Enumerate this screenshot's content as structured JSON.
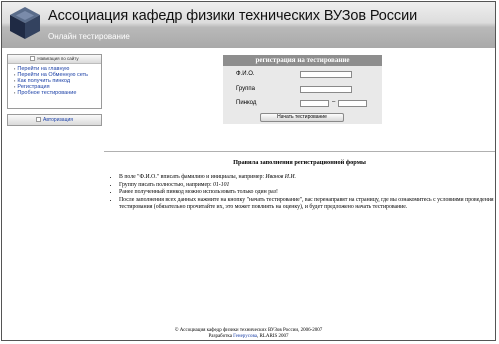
{
  "header": {
    "title": "Ассоциация кафедр физики технических ВУЗов России",
    "subtitle": "Онлайн тестирование"
  },
  "sidebar": {
    "nav_title": "Навигация по сайту",
    "items": [
      {
        "label": "Перейти на главную"
      },
      {
        "label": "Перейти на Обменную сеть"
      },
      {
        "label": "Как получить пинкод"
      },
      {
        "label": "Регистрация"
      },
      {
        "label": "Пробное тестирование"
      }
    ],
    "auth_label": "Авторизация"
  },
  "registration": {
    "title": "регистрация на тестирование",
    "fio_label": "Ф.И.О.",
    "group_label": "Группа",
    "pincode_label": "Пинкод",
    "pincode_separator": "–",
    "submit_label": "Начать тестирование",
    "fio_value": "",
    "group_value": "",
    "pincode_part1": "",
    "pincode_part2": ""
  },
  "rules": {
    "heading": "Правила заполнения регистрационной формы",
    "items": [
      {
        "text": "В поле \"Ф.И.О.\" вписать фамилию и инициалы, например: ",
        "example": "Иванов И.И."
      },
      {
        "text": "Группу писать полностью, например: ",
        "example": "01-101"
      },
      {
        "text": "Ранее полученный пинкод можно использовать только один раз!",
        "example": ""
      },
      {
        "text": "После заполнения всех данных нажмите на кнопку \"начать тестирование\", вас перенаправят на страницу, где вы ознакомитесь с условиями проведения тестирования (обязательно прочитайте их, это может повлиять на оценку), и будет предложено начать тестирование.",
        "example": ""
      }
    ]
  },
  "footer": {
    "copyright": "© Ассоциация кафедр физики технических ВУЗов России, 2006-2007",
    "dev_prefix": "Разработка ",
    "dev_link": "Генерусова",
    "dev_suffix": ", RLARIS 2007"
  }
}
